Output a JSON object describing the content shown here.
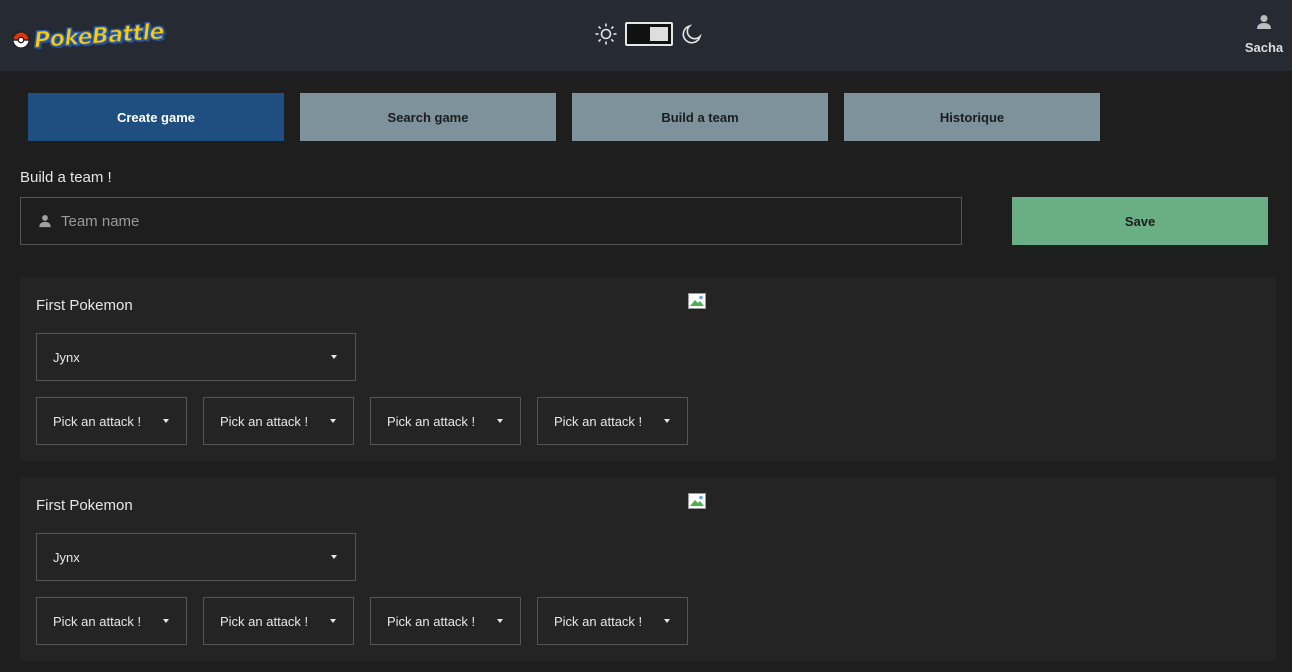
{
  "header": {
    "logo_text": "PokeBattle",
    "theme": {
      "sun_icon": "sun-icon",
      "moon_icon": "moon-icon",
      "mode": "dark"
    },
    "user": {
      "icon": "person-icon",
      "name": "Sacha"
    }
  },
  "nav": [
    {
      "label": "Create game",
      "state": "active"
    },
    {
      "label": "Search game",
      "state": "inactive"
    },
    {
      "label": "Build a team",
      "state": "inactive"
    },
    {
      "label": "Historique",
      "state": "inactive"
    }
  ],
  "builder": {
    "title": "Build a team !",
    "team_name_placeholder": "Team name",
    "team_name_value": "",
    "save_label": "Save"
  },
  "pokemon_slots": [
    {
      "title": "First Pokemon",
      "selected_pokemon": "Jynx",
      "attacks": [
        "Pick an attack !",
        "Pick an attack !",
        "Pick an attack !",
        "Pick an attack !"
      ]
    },
    {
      "title": "First Pokemon",
      "selected_pokemon": "Jynx",
      "attacks": [
        "Pick an attack !",
        "Pick an attack !",
        "Pick an attack !",
        "Pick an attack !"
      ]
    }
  ],
  "colors": {
    "background": "#1e1e1e",
    "topbar": "#252a33",
    "primary_button": "#1f4e80",
    "secondary_button": "#7e929b",
    "save_button": "#6aae86",
    "card": "#242424"
  }
}
